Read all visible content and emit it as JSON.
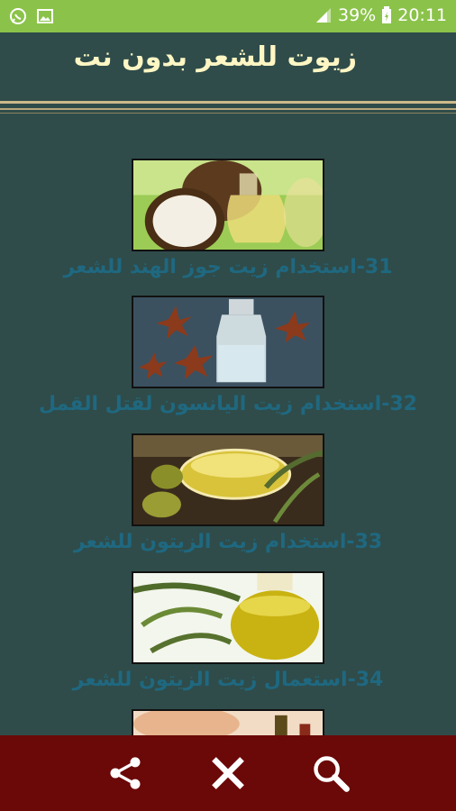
{
  "status_bar": {
    "battery": "39%",
    "time": "20:11",
    "icons": [
      "whatsapp-icon",
      "image-icon",
      "signal-icon",
      "battery-icon"
    ]
  },
  "header": {
    "title": "زيوت للشعر بدون نت"
  },
  "items": [
    {
      "label": "31-استخدام زيت جوز الهند للشعر"
    },
    {
      "label": "32-استخدام زيت اليانسون لقتل القمل"
    },
    {
      "label": "33-استخدام زيت الزيتون للشعر"
    },
    {
      "label": "34-استعمال زيت الزيتون للشعر"
    },
    {
      "label": ""
    }
  ],
  "bottom_bar": {
    "icons": [
      "share-icon",
      "close-icon",
      "search-icon"
    ]
  },
  "colors": {
    "background": "#2f4c4a",
    "status_bar": "#8bc34a",
    "title": "#fff6c4",
    "item_label": "#1f6880",
    "bottom_bar": "#6b0808"
  }
}
